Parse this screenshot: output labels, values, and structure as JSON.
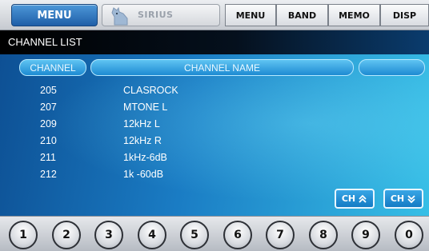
{
  "toolbar": {
    "menu_main": "MENU",
    "source_label": "SIRIUS",
    "buttons": [
      "MENU",
      "BAND",
      "MEMO",
      "DISP"
    ]
  },
  "panel": {
    "title": "CHANNEL LIST",
    "columns": {
      "channel": "CHANNEL",
      "name": "CHANNEL NAME",
      "extra": ""
    },
    "rows": [
      {
        "channel": "205",
        "name": "CLASROCK"
      },
      {
        "channel": "207",
        "name": "MTONE L"
      },
      {
        "channel": "209",
        "name": "12kHz L"
      },
      {
        "channel": "210",
        "name": "12kHz R"
      },
      {
        "channel": "211",
        "name": "1kHz-6dB"
      },
      {
        "channel": "212",
        "name": "1k -60dB"
      }
    ],
    "ch_up": "CH",
    "ch_down": "CH"
  },
  "keypad": [
    "1",
    "2",
    "3",
    "4",
    "5",
    "6",
    "7",
    "8",
    "9",
    "0"
  ],
  "colors": {
    "accent": "#1f5fa8",
    "panel": "#1a7cc4"
  },
  "icons": {
    "source": "dog-logo-icon",
    "up": "double-chevron-up-icon",
    "down": "double-chevron-down-icon"
  }
}
